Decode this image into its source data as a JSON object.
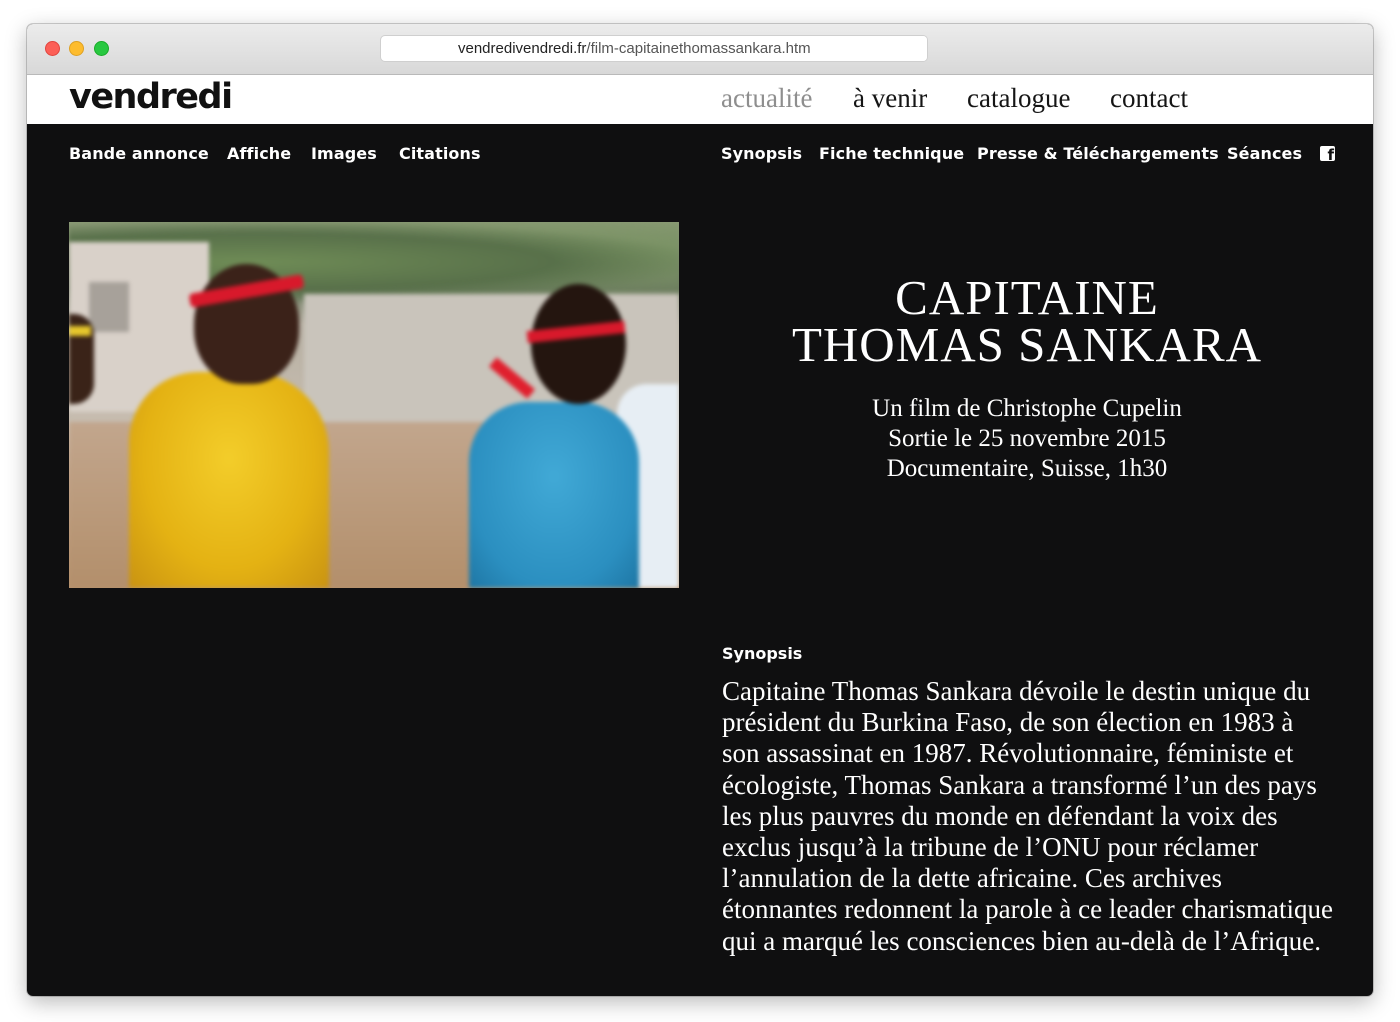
{
  "browser": {
    "url_domain": "vendredivendredi.fr",
    "url_path": "/film-capitainethomassankara.htm"
  },
  "site": {
    "logo": "vendredi",
    "main_nav": [
      "actualité",
      "à venir",
      "catalogue",
      "contact"
    ],
    "active_nav": "actualité"
  },
  "subnav": {
    "left": [
      "Bande annonce",
      "Affiche",
      "Images",
      "Citations"
    ],
    "right": [
      "Synopsis",
      "Fiche technique",
      "Presse & Téléchargements",
      "Séances"
    ],
    "social_icon": "facebook-icon"
  },
  "film": {
    "title_line1": "CAPITAINE",
    "title_line2": "THOMAS SANKARA",
    "director_line": "Un film de Christophe Cupelin",
    "release_line": "Sortie le 25 novembre 2015",
    "info_line": "Documentaire, Suisse, 1h30"
  },
  "synopsis": {
    "heading": "Synopsis",
    "text": "Capitaine Thomas Sankara dévoile le destin unique du président du Burkina Faso, de son élection en 1983 à son assassinat en 1987. Révolutionnaire, féministe et écologiste, Thomas Sankara a transformé l’un des pays les plus pauvres du monde en défendant la voix des exclus jusqu’à la tribune de l’ONU pour réclamer l’annulation de la dette africaine. Ces archives étonnantes redonnent la parole à ce leader charismatique qui a marqué les consciences bien au-delà de l’Afrique."
  },
  "colors": {
    "page_background": "#0f0f10",
    "header_background": "#ffffff",
    "active_nav": "#8e8e8e"
  }
}
